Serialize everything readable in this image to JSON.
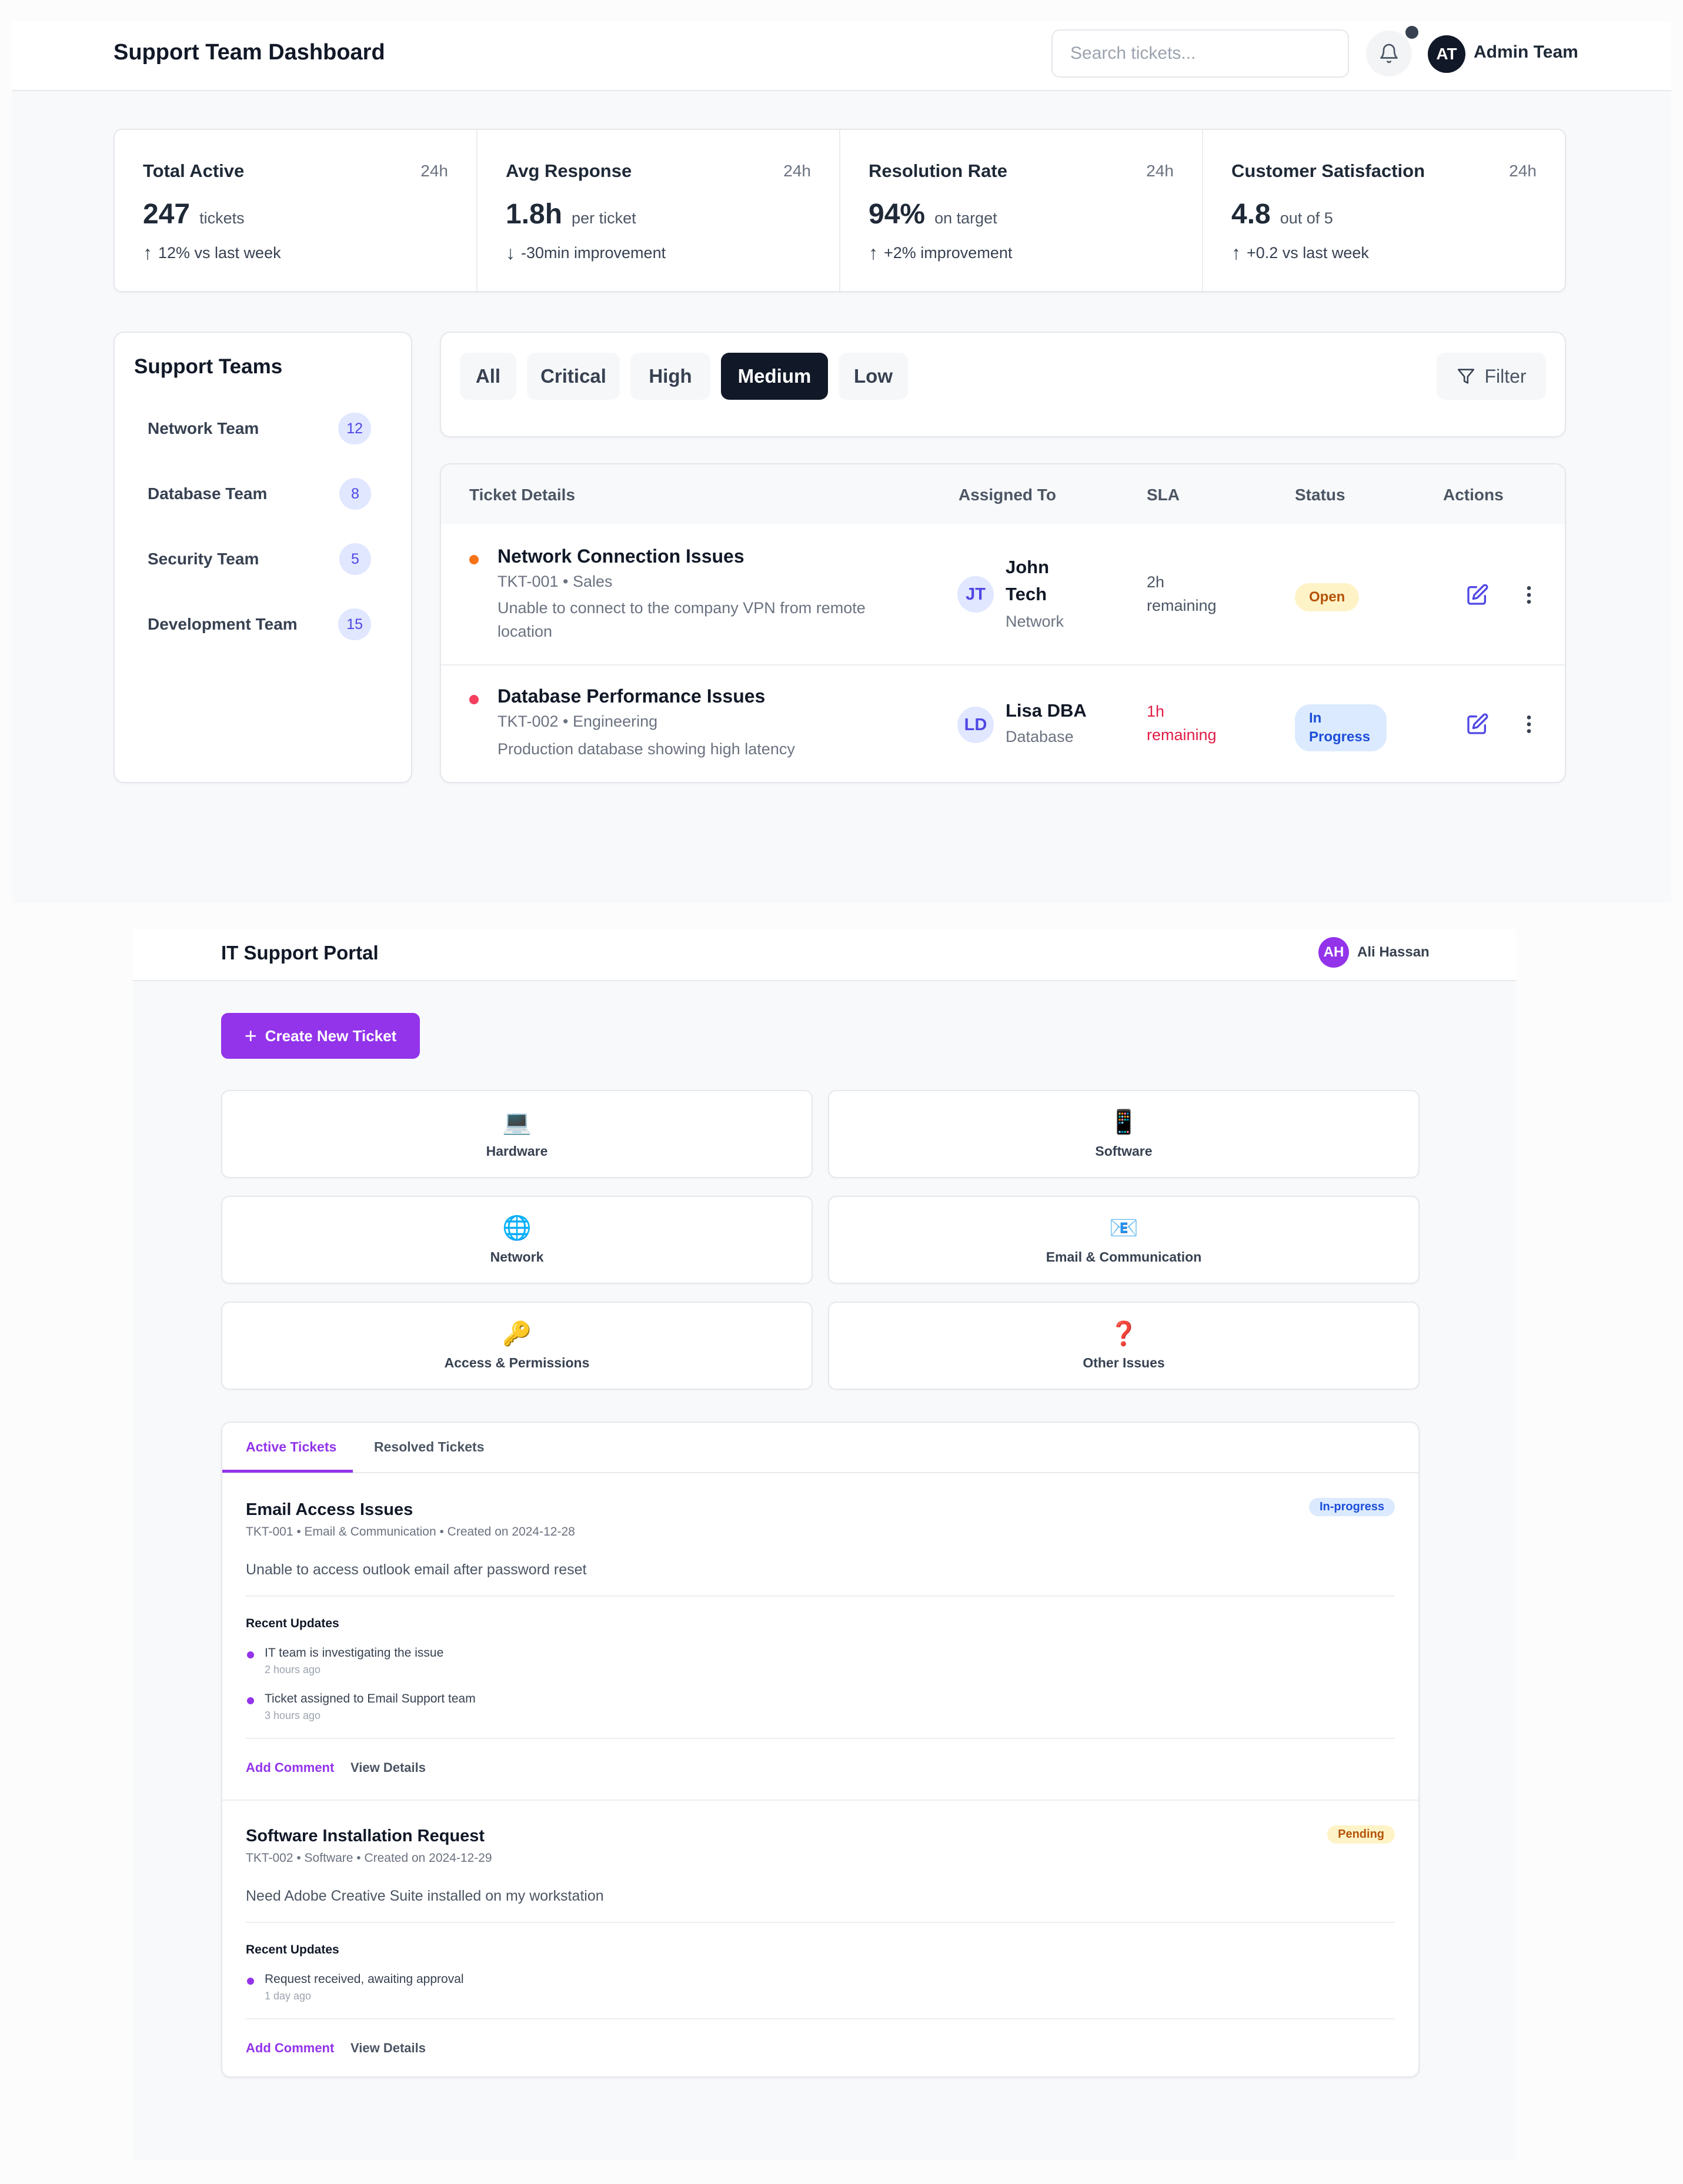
{
  "dashboard": {
    "title": "Support Team Dashboard",
    "search": {
      "placeholder": "Search tickets..."
    },
    "notifications": {
      "icon": "bell-icon",
      "has_unread": true
    },
    "user": {
      "initials": "AT",
      "name": "Admin Team"
    },
    "stats": [
      {
        "label": "Total Active",
        "period": "24h",
        "value": "247",
        "unit": "tickets",
        "trend_dir": "up",
        "trend": "12% vs last week"
      },
      {
        "label": "Avg Response",
        "period": "24h",
        "value": "1.8h",
        "unit": "per ticket",
        "trend_dir": "down",
        "trend": "-30min improvement"
      },
      {
        "label": "Resolution Rate",
        "period": "24h",
        "value": "94%",
        "unit": "on target",
        "trend_dir": "up",
        "trend": "+2% improvement"
      },
      {
        "label": "Customer Satisfaction",
        "period": "24h",
        "value": "4.8",
        "unit": "out of 5",
        "trend_dir": "up",
        "trend": "+0.2 vs last week"
      }
    ],
    "teams": {
      "title": "Support Teams",
      "items": [
        {
          "name": "Network Team",
          "count": "12"
        },
        {
          "name": "Database Team",
          "count": "8"
        },
        {
          "name": "Security Team",
          "count": "5"
        },
        {
          "name": "Development Team",
          "count": "15"
        }
      ]
    },
    "filters": {
      "chips": [
        {
          "label": "All",
          "active": false
        },
        {
          "label": "Critical",
          "active": false
        },
        {
          "label": "High",
          "active": false
        },
        {
          "label": "Medium",
          "active": true
        },
        {
          "label": "Low",
          "active": false
        }
      ],
      "filter_label": "Filter"
    },
    "table": {
      "columns": [
        "Ticket Details",
        "Assigned To",
        "SLA",
        "Status",
        "Actions"
      ],
      "rows": [
        {
          "priority_color": "#f97316",
          "title": "Network Connection Issues",
          "meta": "TKT-001 • Sales",
          "description": "Unable to connect to the company VPN from remote location",
          "assignee_initials": "JT",
          "assignee_name": "John Tech",
          "assignee_team": "Network",
          "sla": "2h remaining",
          "sla_urgent": false,
          "status": "Open"
        },
        {
          "priority_color": "#f43f5e",
          "title": "Database Performance Issues",
          "meta": "TKT-002 • Engineering",
          "description": "Production database showing high latency",
          "assignee_initials": "LD",
          "assignee_name": "Lisa DBA",
          "assignee_team": "Database",
          "sla": "1h remaining",
          "sla_urgent": true,
          "status": "In Progress"
        }
      ]
    }
  },
  "portal": {
    "title": "IT Support Portal",
    "user": {
      "initials": "AH",
      "name": "Ali Hassan"
    },
    "create_button": "Create New Ticket",
    "categories": [
      {
        "label": "Hardware",
        "icon": "laptop-icon",
        "glyph": "💻"
      },
      {
        "label": "Software",
        "icon": "mobile-app-icon",
        "glyph": "📱"
      },
      {
        "label": "Network",
        "icon": "globe-icon",
        "glyph": "🌐"
      },
      {
        "label": "Email & Communication",
        "icon": "email-icon",
        "glyph": "📧"
      },
      {
        "label": "Access & Permissions",
        "icon": "key-icon",
        "glyph": "🔑"
      },
      {
        "label": "Other Issues",
        "icon": "question-icon",
        "glyph": "❓"
      }
    ],
    "tabs": [
      {
        "label": "Active Tickets",
        "active": true
      },
      {
        "label": "Resolved Tickets",
        "active": false
      }
    ],
    "tickets": [
      {
        "title": "Email Access Issues",
        "meta": "TKT-001 • Email & Communication • Created on 2024-12-28",
        "description": "Unable to access outlook email after password reset",
        "status": "In-progress",
        "updates_title": "Recent Updates",
        "updates": [
          {
            "text": "IT team is investigating the issue",
            "time": "2 hours ago"
          },
          {
            "text": "Ticket assigned to Email Support team",
            "time": "3 hours ago"
          }
        ],
        "add_comment": "Add Comment",
        "view_details": "View Details"
      },
      {
        "title": "Software Installation Request",
        "meta": "TKT-002 • Software • Created on 2024-12-29",
        "description": "Need Adobe Creative Suite installed on my workstation",
        "status": "Pending",
        "updates_title": "Recent Updates",
        "updates": [
          {
            "text": "Request received, awaiting approval",
            "time": "1 day ago"
          }
        ],
        "add_comment": "Add Comment",
        "view_details": "View Details"
      }
    ]
  }
}
